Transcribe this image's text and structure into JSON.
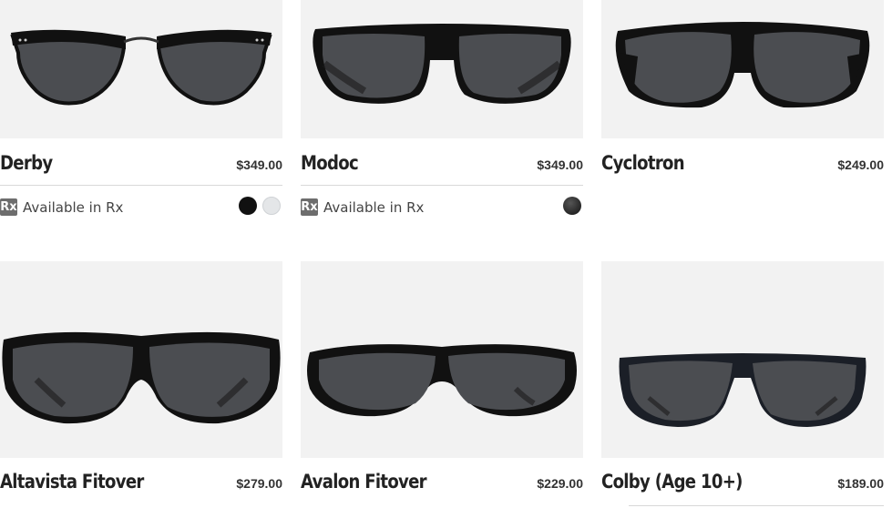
{
  "products": [
    {
      "name": "Derby",
      "price": "$349.00",
      "rx_label": "Available in Rx",
      "rx_badge": "Rx",
      "swatches": [
        "#111111",
        "#e4e6e8"
      ],
      "image": "sunglasses-derby"
    },
    {
      "name": "Modoc",
      "price": "$349.00",
      "rx_label": "Available in Rx",
      "rx_badge": "Rx",
      "swatches": [
        "#2a2a2a"
      ],
      "image": "sunglasses-modoc"
    },
    {
      "name": "Cyclotron",
      "price": "$249.00",
      "image": "sunglasses-cyclotron"
    },
    {
      "name": "Altavista Fitover",
      "price": "$279.00",
      "image": "sunglasses-altavista-fitover"
    },
    {
      "name": "Avalon Fitover",
      "price": "$229.00",
      "image": "sunglasses-avalon-fitover"
    },
    {
      "name": "Colby (Age 10+)",
      "price": "$189.00",
      "image": "sunglasses-colby"
    }
  ],
  "colors": {
    "image_bg": "#f2f2f2",
    "lens": "#4a4c50",
    "frame": "#111111",
    "rx_badge_bg": "#6d6d6d"
  }
}
